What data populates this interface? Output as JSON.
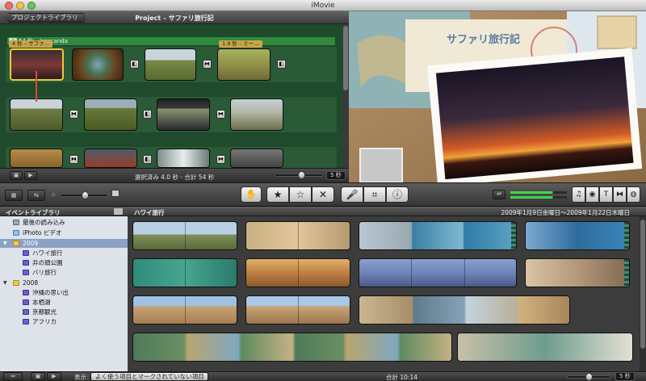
{
  "window": {
    "title": "iMovie"
  },
  "project": {
    "library_button": "プロジェクトライブラリ",
    "title": "Project – サファリ旅行記",
    "music_track": "54 秒 – Jaracanda",
    "clip_tags": [
      "4 秒 – サファ…",
      "1.9 秒 – ミー…"
    ],
    "status": "選択済み 4.0 秒 - 合計 54 秒",
    "thumb_size": "5 秒"
  },
  "viewer": {
    "title_text": "サファリ旅行記"
  },
  "event_library": {
    "title": "イベントライブラリ",
    "items": [
      {
        "label": "最後の読み込み",
        "kind": "lib"
      },
      {
        "label": "iPhoto ビデオ",
        "kind": "photo"
      },
      {
        "label": "2009",
        "kind": "year",
        "expanded": true
      },
      {
        "label": "ハワイ旅行",
        "kind": "event"
      },
      {
        "label": "井の頭公園",
        "kind": "event"
      },
      {
        "label": "バリ旅行",
        "kind": "event"
      },
      {
        "label": "2008",
        "kind": "year",
        "expanded": true
      },
      {
        "label": "沖縄の思い出",
        "kind": "event"
      },
      {
        "label": "本栖湖",
        "kind": "event"
      },
      {
        "label": "京都観光",
        "kind": "event"
      },
      {
        "label": "アフリカ",
        "kind": "event"
      }
    ]
  },
  "event_browser": {
    "title": "ハワイ旅行",
    "date_range": "2009年1月9日金曜日〜2009年1月22日木曜日"
  },
  "bottom": {
    "show_label": "表示：",
    "show_select": "よく使う項目とマークされていない項目",
    "total": "合計 10:14",
    "thumb_size": "5 秒"
  },
  "toolbar": {
    "buttons": [
      "hand",
      "star",
      "star-outline",
      "reject",
      "voiceover",
      "crop",
      "info"
    ],
    "right_buttons": [
      "music",
      "photo",
      "title",
      "transition",
      "maps"
    ]
  },
  "colors": {
    "selection": "#f0c83a",
    "project_bg": "#1f4a2c",
    "music": "#2f8a3e",
    "sidebar_sel": "#8aa3c4"
  }
}
